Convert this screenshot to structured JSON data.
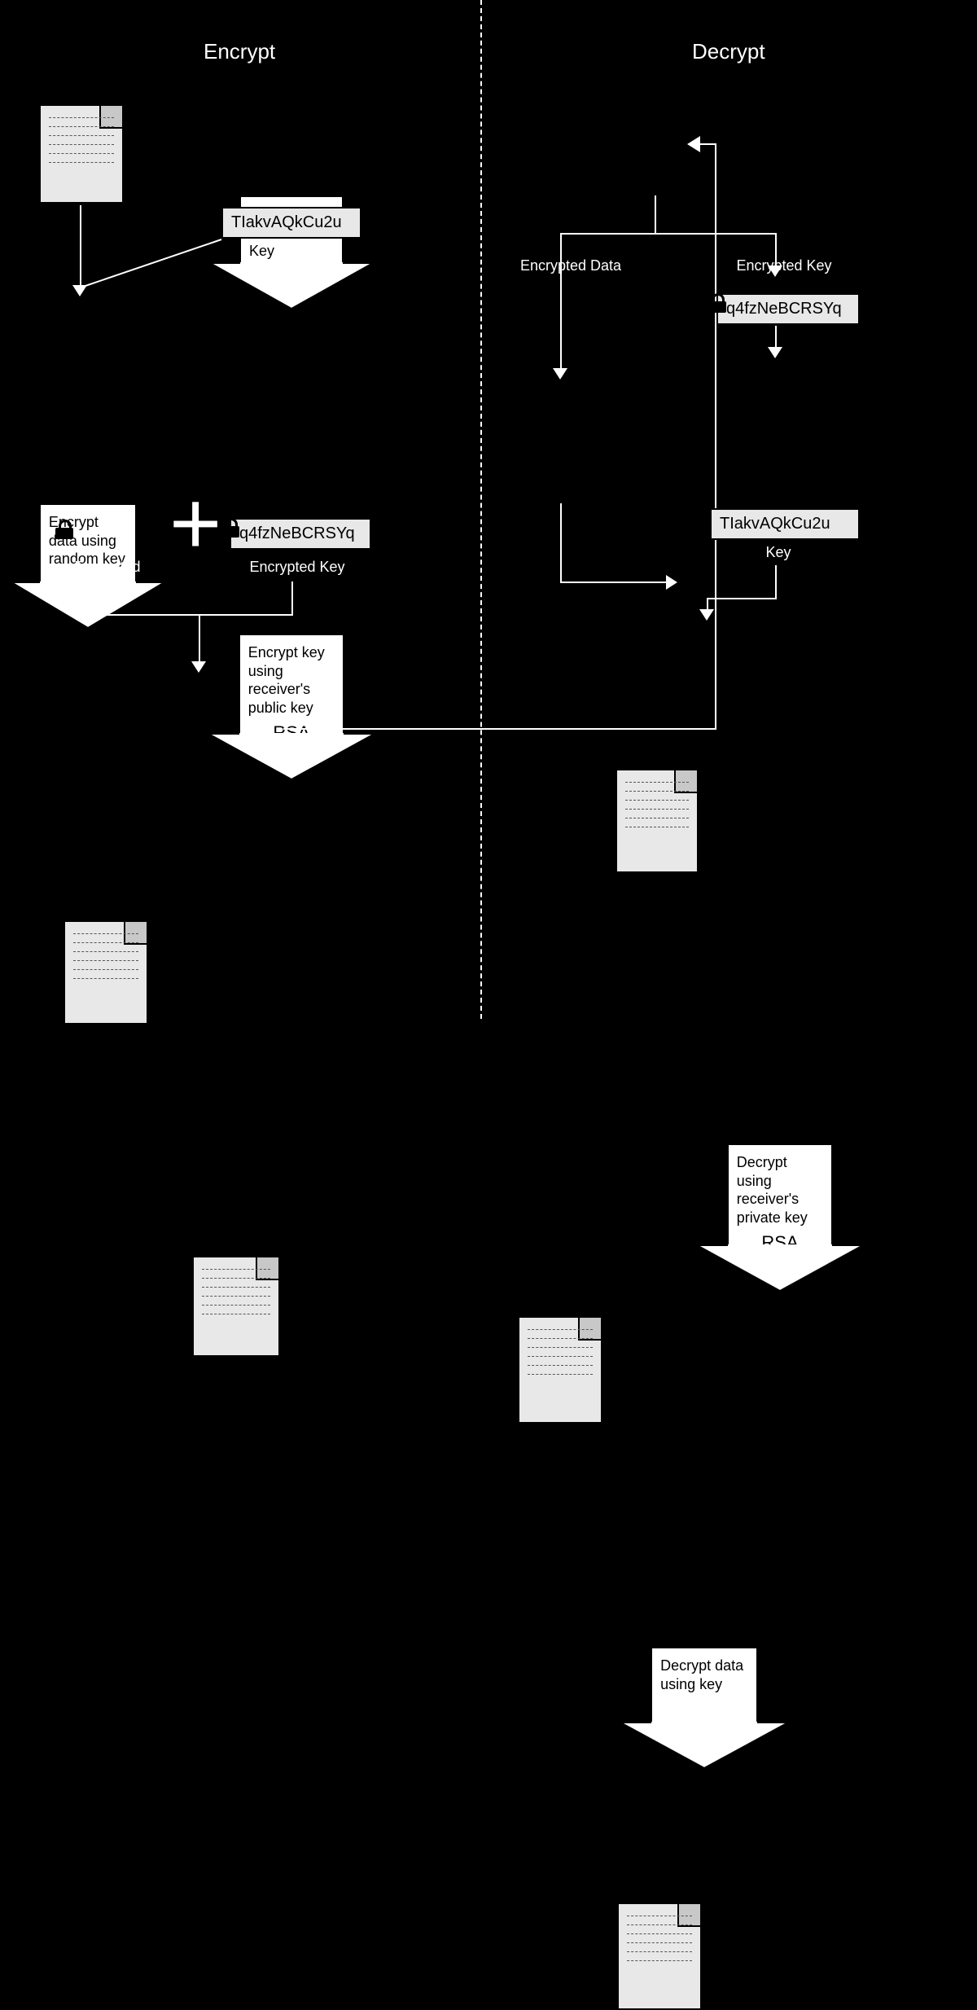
{
  "titles": {
    "encrypt": "Encrypt",
    "decrypt": "Decrypt"
  },
  "keys": {
    "random": "TIakvAQkCu2u",
    "encrypted": "q4fzNeBCRSYq",
    "random2": "TIakvAQkCu2u"
  },
  "arrows": {
    "genKey": "Generate Random Key",
    "encData": "Encrypt data using random key",
    "encKey": "Encrypt key using receiver's public key",
    "decKey": "Decrypt using receiver's private key",
    "decData": "Decrypt data using key"
  },
  "rsa": "RSA",
  "labels": {
    "encDataL": "Encrypted Data",
    "encKeyL": "Encrypted Key",
    "encDataL2": "Encrypted Data",
    "encKeyL2": "Encrypted Key",
    "keyL": "Key"
  }
}
